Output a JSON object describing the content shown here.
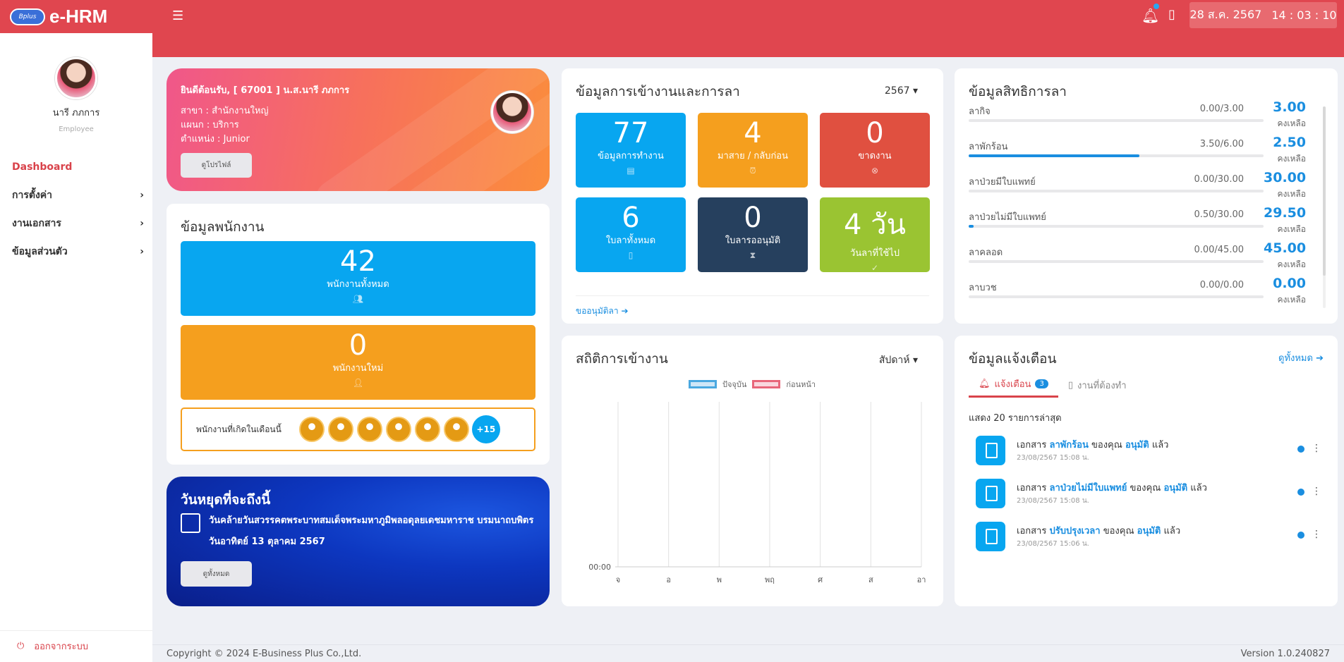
{
  "brand": {
    "badge": "Bplus",
    "name": "e-HRM"
  },
  "header": {
    "date": "28 ส.ค. 2567",
    "time": "14 : 03 : 10"
  },
  "profile": {
    "name": "นารี ภภการ",
    "role": "Employee"
  },
  "nav": [
    {
      "label": "Dashboard",
      "active": true
    },
    {
      "label": "การตั้งค่า"
    },
    {
      "label": "งานเอกสาร"
    },
    {
      "label": "ข้อมูลส่วนตัว"
    }
  ],
  "logout": "ออกจากระบบ",
  "welcome": {
    "greeting": "ยินดีต้อนรับ, [ 67001 ] น.ส.นารี ภภการ",
    "branch": "สาขา : สำนักงานใหญ่",
    "dept": "แผนก : บริการ",
    "position": "ตำแหน่ง : Junior",
    "button": "ดูโปรไฟล์"
  },
  "employees": {
    "title": "ข้อมูลพนักงาน",
    "total": {
      "value": "42",
      "label": "พนักงานทั้งหมด"
    },
    "new": {
      "value": "0",
      "label": "พนักงานใหม่"
    },
    "birthday": {
      "label": "พนักงานที่เกิดในเดือนนี้",
      "more": "+15"
    }
  },
  "holiday": {
    "title": "วันหยุดที่จะถึงนี้",
    "name": "วันคล้ายวันสวรรคตพระบาทสมเด็จพระมหาภูมิพลอดุลยเดชมหาราช บรมนาถบพิตร",
    "date": "วันอาทิตย์ 13 ตุลาคม 2567",
    "button": "ดูทั้งหมด"
  },
  "attendance": {
    "title": "ข้อมูลการเข้างานและการลา",
    "year": "2567",
    "tiles": [
      {
        "value": "77",
        "label": "ข้อมูลการทำงาน",
        "color": "#08a6f0"
      },
      {
        "value": "4",
        "label": "มาสาย / กลับก่อน",
        "color": "#f59f1e"
      },
      {
        "value": "0",
        "label": "ขาดงาน",
        "color": "#e05040"
      },
      {
        "value": "6",
        "label": "ใบลาทั้งหมด",
        "color": "#08a6f0"
      },
      {
        "value": "0",
        "label": "ใบลารออนุมัติ",
        "color": "#26405e"
      },
      {
        "value": "4 วัน",
        "label": "วันลาที่ใช้ไป",
        "color": "#9ac432"
      }
    ],
    "link": "ขออนุมัติลา"
  },
  "leave": {
    "title": "ข้อมูลสิทธิการลา",
    "remaining_label": "คงเหลือ",
    "rows": [
      {
        "name": "ลากิจ",
        "used": "0.00/3.00",
        "remaining": "3.00",
        "progress": 0
      },
      {
        "name": "ลาพักร้อน",
        "used": "3.50/6.00",
        "remaining": "2.50",
        "progress": 0.58
      },
      {
        "name": "ลาป่วยมีใบแพทย์",
        "used": "0.00/30.00",
        "remaining": "30.00",
        "progress": 0
      },
      {
        "name": "ลาป่วยไม่มีใบแพทย์",
        "used": "0.50/30.00",
        "remaining": "29.50",
        "progress": 0.017
      },
      {
        "name": "ลาคลอด",
        "used": "0.00/45.00",
        "remaining": "45.00",
        "progress": 0
      },
      {
        "name": "ลาบวช",
        "used": "0.00/0.00",
        "remaining": "0.00",
        "progress": 0
      }
    ]
  },
  "stats": {
    "title": "สถิติการเข้างาน",
    "period": "สัปดาห์",
    "legend": [
      "ปัจจุบัน",
      "ก่อนหน้า"
    ]
  },
  "chart_data": {
    "type": "line",
    "categories": [
      "จ",
      "อ",
      "พ",
      "พฤ",
      "ศ",
      "ส",
      "อา"
    ],
    "ytick": "00:00",
    "series": [
      {
        "name": "ปัจจุบัน",
        "values": [],
        "color": "#4aa8e0"
      },
      {
        "name": "ก่อนหน้า",
        "values": [],
        "color": "#e8667a"
      }
    ]
  },
  "notifications": {
    "title": "ข้อมูลแจ้งเตือน",
    "view_all": "ดูทั้งหมด",
    "tabs": [
      {
        "label": "แจ้งเตือน",
        "count": "3"
      },
      {
        "label": "งานที่ต้องทำ"
      }
    ],
    "showing": "แสดง 20 รายการล่าสุด",
    "items": [
      {
        "prefix": "เอกสาร",
        "doc": "ลาพักร้อน",
        "mid": "ของคุณ",
        "status": "อนุมัติ",
        "suffix": "แล้ว",
        "time": "23/08/2567 15:08 น."
      },
      {
        "prefix": "เอกสาร",
        "doc": "ลาป่วยไม่มีใบแพทย์",
        "mid": "ของคุณ",
        "status": "อนุมัติ",
        "suffix": "แล้ว",
        "time": "23/08/2567 15:08 น."
      },
      {
        "prefix": "เอกสาร",
        "doc": "ปรับปรุงเวลา",
        "mid": "ของคุณ",
        "status": "อนุมัติ",
        "suffix": "แล้ว",
        "time": "23/08/2567 15:06 น."
      }
    ]
  },
  "footer": {
    "copyright": "Copyright © 2024 E-Business Plus Co.,Ltd.",
    "version": "Version 1.0.240827"
  }
}
